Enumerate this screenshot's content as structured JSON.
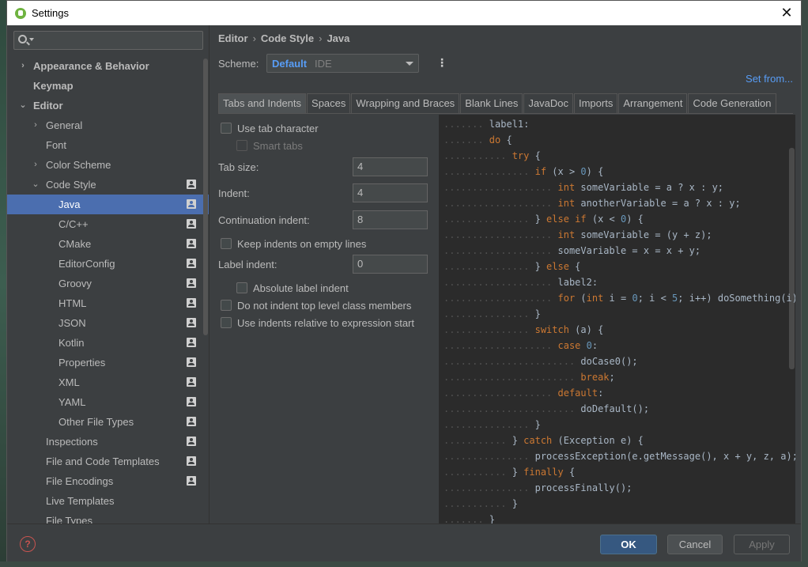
{
  "window": {
    "title": "Settings"
  },
  "search": {
    "placeholder": ""
  },
  "tree": [
    {
      "label": "Appearance & Behavior",
      "level": 0,
      "arrow": "›",
      "bold": true,
      "pin": false,
      "selected": false
    },
    {
      "label": "Keymap",
      "level": 0,
      "arrow": "",
      "bold": true,
      "pin": false,
      "selected": false
    },
    {
      "label": "Editor",
      "level": 0,
      "arrow": "⌄",
      "bold": true,
      "pin": false,
      "selected": false
    },
    {
      "label": "General",
      "level": 1,
      "arrow": "›",
      "bold": false,
      "pin": false,
      "selected": false
    },
    {
      "label": "Font",
      "level": 1,
      "arrow": "",
      "bold": false,
      "pin": false,
      "selected": false
    },
    {
      "label": "Color Scheme",
      "level": 1,
      "arrow": "›",
      "bold": false,
      "pin": false,
      "selected": false
    },
    {
      "label": "Code Style",
      "level": 1,
      "arrow": "⌄",
      "bold": false,
      "pin": true,
      "selected": false
    },
    {
      "label": "Java",
      "level": 2,
      "arrow": "",
      "bold": false,
      "pin": true,
      "selected": true
    },
    {
      "label": "C/C++",
      "level": 2,
      "arrow": "",
      "bold": false,
      "pin": true,
      "selected": false
    },
    {
      "label": "CMake",
      "level": 2,
      "arrow": "",
      "bold": false,
      "pin": true,
      "selected": false
    },
    {
      "label": "EditorConfig",
      "level": 2,
      "arrow": "",
      "bold": false,
      "pin": true,
      "selected": false
    },
    {
      "label": "Groovy",
      "level": 2,
      "arrow": "",
      "bold": false,
      "pin": true,
      "selected": false
    },
    {
      "label": "HTML",
      "level": 2,
      "arrow": "",
      "bold": false,
      "pin": true,
      "selected": false
    },
    {
      "label": "JSON",
      "level": 2,
      "arrow": "",
      "bold": false,
      "pin": true,
      "selected": false
    },
    {
      "label": "Kotlin",
      "level": 2,
      "arrow": "",
      "bold": false,
      "pin": true,
      "selected": false
    },
    {
      "label": "Properties",
      "level": 2,
      "arrow": "",
      "bold": false,
      "pin": true,
      "selected": false
    },
    {
      "label": "XML",
      "level": 2,
      "arrow": "",
      "bold": false,
      "pin": true,
      "selected": false
    },
    {
      "label": "YAML",
      "level": 2,
      "arrow": "",
      "bold": false,
      "pin": true,
      "selected": false
    },
    {
      "label": "Other File Types",
      "level": 2,
      "arrow": "",
      "bold": false,
      "pin": true,
      "selected": false
    },
    {
      "label": "Inspections",
      "level": 1,
      "arrow": "",
      "bold": false,
      "pin": true,
      "selected": false
    },
    {
      "label": "File and Code Templates",
      "level": 1,
      "arrow": "",
      "bold": false,
      "pin": true,
      "selected": false
    },
    {
      "label": "File Encodings",
      "level": 1,
      "arrow": "",
      "bold": false,
      "pin": true,
      "selected": false
    },
    {
      "label": "Live Templates",
      "level": 1,
      "arrow": "",
      "bold": false,
      "pin": false,
      "selected": false
    },
    {
      "label": "File Types",
      "level": 1,
      "arrow": "",
      "bold": false,
      "pin": false,
      "selected": false
    }
  ],
  "breadcrumb": [
    "Editor",
    "Code Style",
    "Java"
  ],
  "scheme": {
    "label": "Scheme:",
    "value": "Default",
    "sub": "IDE"
  },
  "set_from": "Set from...",
  "tabs": [
    "Tabs and Indents",
    "Spaces",
    "Wrapping and Braces",
    "Blank Lines",
    "JavaDoc",
    "Imports",
    "Arrangement",
    "Code Generation"
  ],
  "active_tab": 0,
  "options": {
    "use_tab_character": "Use tab character",
    "smart_tabs": "Smart tabs",
    "tab_size_label": "Tab size:",
    "tab_size": "4",
    "indent_label": "Indent:",
    "indent": "4",
    "continuation_label": "Continuation indent:",
    "continuation": "8",
    "keep_indents": "Keep indents on empty lines",
    "label_indent_label": "Label indent:",
    "label_indent": "0",
    "absolute_label": "Absolute label indent",
    "no_indent_top": "Do not indent top level class members",
    "relative_indents": "Use indents relative to expression start"
  },
  "code_lines": [
    [
      [
        "lbl",
        "label1:"
      ]
    ],
    [
      [
        "kw",
        "do"
      ],
      [
        "",
        " {"
      ]
    ],
    [
      [
        "kw",
        "try"
      ],
      [
        "",
        " {"
      ]
    ],
    [
      [
        "kw",
        "if"
      ],
      [
        "",
        " (x > "
      ],
      [
        "num",
        "0"
      ],
      [
        "",
        ") {"
      ]
    ],
    [
      [
        "kw",
        "int"
      ],
      [
        "",
        " someVariable = a ? x : y;"
      ]
    ],
    [
      [
        "kw",
        "int"
      ],
      [
        "",
        " anotherVariable = a ? x : y;"
      ]
    ],
    [
      [
        "",
        "} "
      ],
      [
        "kw",
        "else if"
      ],
      [
        "",
        " (x < "
      ],
      [
        "num",
        "0"
      ],
      [
        "",
        ") {"
      ]
    ],
    [
      [
        "kw",
        "int"
      ],
      [
        "",
        " someVariable = (y + z);"
      ]
    ],
    [
      [
        "",
        "someVariable = x = x + y;"
      ]
    ],
    [
      [
        "",
        "} "
      ],
      [
        "kw",
        "else"
      ],
      [
        "",
        " {"
      ]
    ],
    [
      [
        "lbl",
        "label2:"
      ]
    ],
    [
      [
        "kw",
        "for"
      ],
      [
        "",
        " ("
      ],
      [
        "kw",
        "int"
      ],
      [
        "",
        " i = "
      ],
      [
        "num",
        "0"
      ],
      [
        "",
        "; i < "
      ],
      [
        "num",
        "5"
      ],
      [
        "",
        "; i++) doSomething(i);"
      ]
    ],
    [
      [
        "",
        "}"
      ]
    ],
    [
      [
        "kw",
        "switch"
      ],
      [
        "",
        " (a) {"
      ]
    ],
    [
      [
        "kw",
        "case"
      ],
      [
        "",
        " "
      ],
      [
        "num",
        "0"
      ],
      [
        "",
        ":"
      ]
    ],
    [
      [
        "",
        "doCase0();"
      ]
    ],
    [
      [
        "kw",
        "break"
      ],
      [
        "",
        ";"
      ]
    ],
    [
      [
        "kw",
        "default"
      ],
      [
        "",
        ":"
      ]
    ],
    [
      [
        "",
        "doDefault();"
      ]
    ],
    [
      [
        "",
        "}"
      ]
    ],
    [
      [
        "",
        "} "
      ],
      [
        "kw",
        "catch"
      ],
      [
        "",
        " (Exception e) {"
      ]
    ],
    [
      [
        "",
        "processException(e.getMessage(), x + y, z, a);"
      ]
    ],
    [
      [
        "",
        "} "
      ],
      [
        "kw",
        "finally"
      ],
      [
        "",
        " {"
      ]
    ],
    [
      [
        "",
        "processFinally();"
      ]
    ],
    [
      [
        "",
        "}"
      ]
    ],
    [
      [
        "",
        "}"
      ]
    ]
  ],
  "code_indent_levels": [
    2,
    2,
    3,
    4,
    5,
    5,
    4,
    5,
    5,
    4,
    5,
    5,
    4,
    4,
    5,
    6,
    6,
    5,
    6,
    4,
    3,
    4,
    3,
    4,
    3,
    2
  ],
  "footer": {
    "help": "?",
    "ok": "OK",
    "cancel": "Cancel",
    "apply": "Apply"
  },
  "colors": {
    "accent": "#4b6eaf",
    "link": "#589df6",
    "keyword": "#cc7832",
    "number": "#6897bb"
  }
}
